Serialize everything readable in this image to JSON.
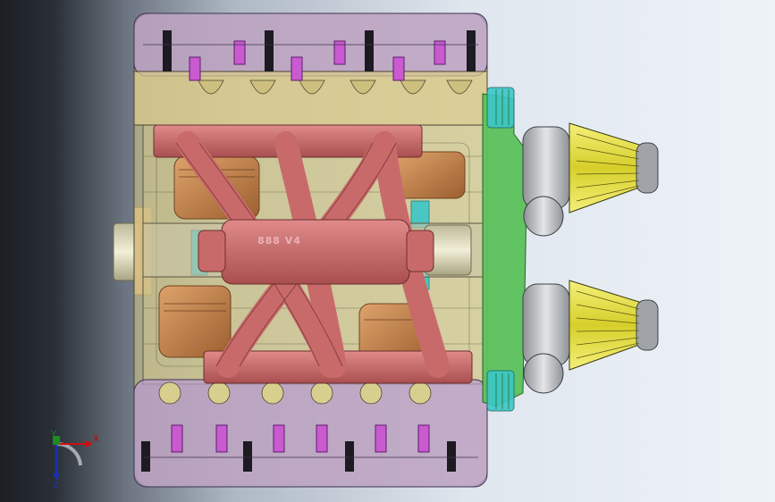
{
  "viewport": {
    "background": [
      "#1b1f24",
      "#eef3f8"
    ]
  },
  "model": {
    "engraving_text": "888 V4",
    "colors": {
      "head_purple": "#b89ccc",
      "block_yellow": "#d8cf8e",
      "manifold_red": "#c96a6a",
      "piston_orange": "#c98a4a",
      "timing_green": "#5cc25c",
      "filter_yellow": "#e6e24a",
      "pulley_cyan": "#3cc7c7",
      "throttle_gray": "#b8bcc0"
    }
  },
  "triad": {
    "x_label": "X",
    "y_label": "Y",
    "z_label": "Z",
    "colors": {
      "x": "#cc1111",
      "y": "#1f8a1f",
      "z": "#1a2fb5"
    }
  }
}
